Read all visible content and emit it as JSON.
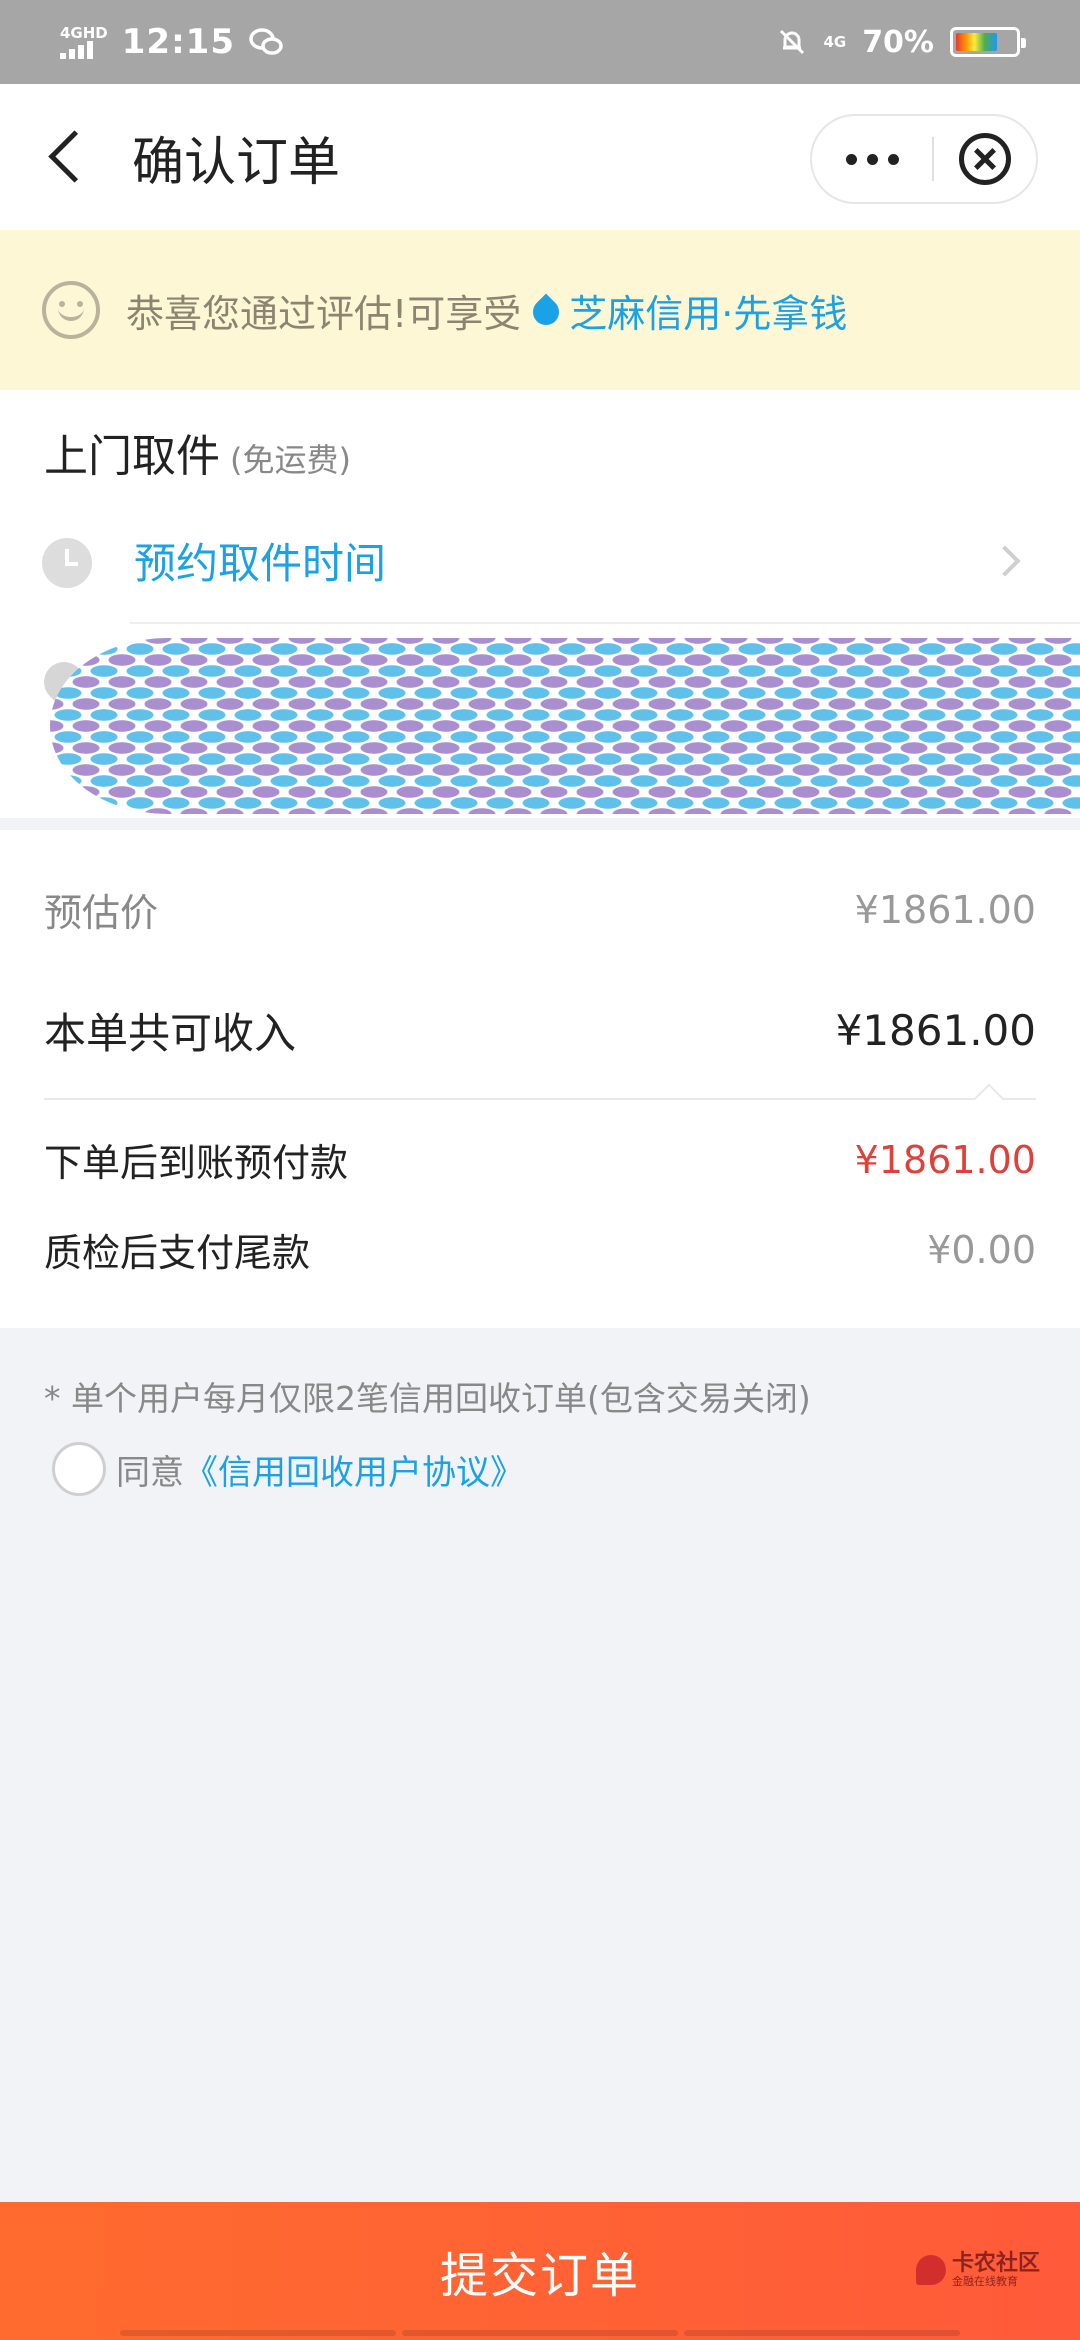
{
  "status_bar": {
    "network_label": "4GHD",
    "time": "12:15",
    "network_right": "4G",
    "battery_pct": "70%",
    "battery_level": 0.7,
    "icons": [
      "signal-icon",
      "wechat-icon",
      "mute-bell-icon",
      "battery-icon"
    ]
  },
  "nav": {
    "title": "确认订单",
    "icons": [
      "back-arrow-icon",
      "more-dots-icon",
      "close-circle-icon"
    ]
  },
  "banner": {
    "text": "恭喜您通过评估!可享受",
    "link": "芝麻信用·先拿钱",
    "icons": [
      "smile-icon",
      "sesame-drop-icon"
    ]
  },
  "pickup": {
    "title": "上门取件",
    "subtitle": "(免运费)",
    "time_placeholder": "预约取件时间",
    "icons": [
      "clock-icon",
      "chevron-right-icon",
      "location-pin-icon"
    ]
  },
  "price": {
    "estimate_label": "预估价",
    "estimate_value": "¥1861.00",
    "total_label": "本单共可收入",
    "total_value": "¥1861.00",
    "prepay_label": "下单后到账预付款",
    "prepay_value": "¥1861.00",
    "balance_label": "质检后支付尾款",
    "balance_value": "¥0.00"
  },
  "notes": {
    "limit": "* 单个用户每月仅限2笔信用回收订单(包含交易关闭)",
    "agree_prefix": "同意",
    "agree_link": "《信用回收用户协议》"
  },
  "footer": {
    "submit": "提交订单",
    "watermark_title": "卡农社区",
    "watermark_sub": "金融在线教育"
  },
  "colors": {
    "accent_blue": "#1aa1e6",
    "price_red": "#e0403a",
    "submit_orange": "#ff5a3a",
    "banner_bg": "#fdf7d6"
  }
}
